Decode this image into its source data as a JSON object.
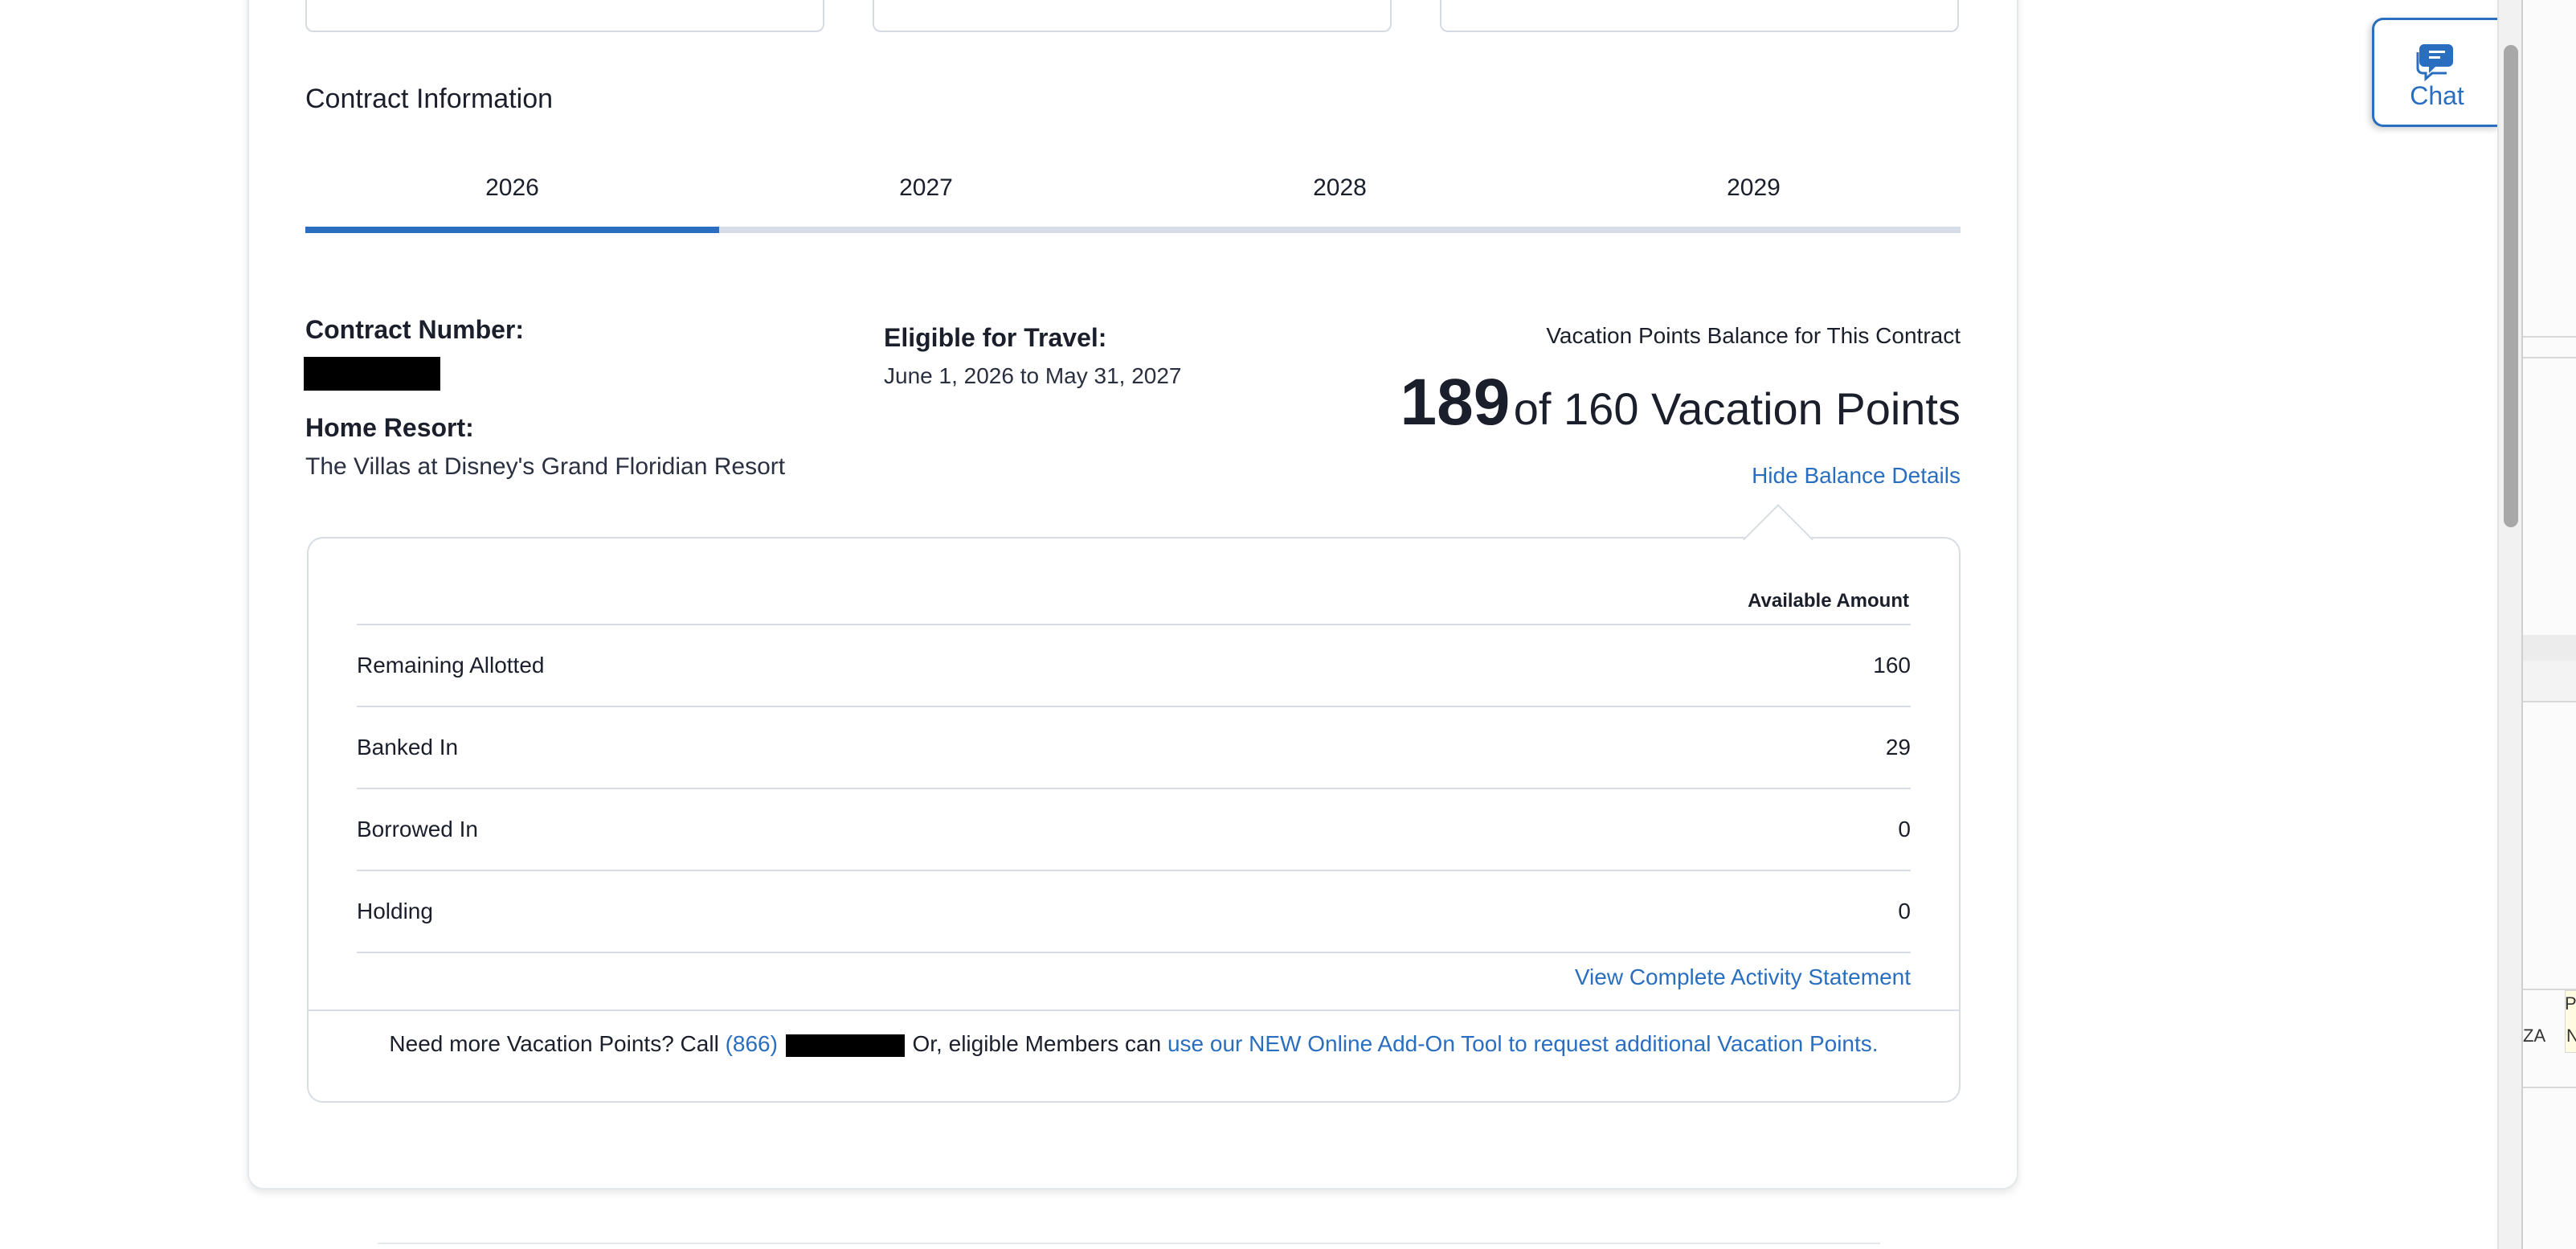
{
  "section": {
    "title": "Contract Information"
  },
  "tabs": [
    {
      "label": "2026",
      "active": true
    },
    {
      "label": "2027",
      "active": false
    },
    {
      "label": "2028",
      "active": false
    },
    {
      "label": "2029",
      "active": false
    }
  ],
  "contract": {
    "number_label": "Contract Number:",
    "home_resort_label": "Home Resort:",
    "home_resort_value": "The Villas at Disney's Grand Floridian Resort",
    "eligible_label": "Eligible for Travel:",
    "eligible_value": "June 1, 2026 to May 31, 2027"
  },
  "balance": {
    "label": "Vacation Points Balance for This Contract",
    "points": "189",
    "rest": "of 160 Vacation Points",
    "hide_link": "Hide Balance Details"
  },
  "details": {
    "column_header": "Available Amount",
    "rows": [
      {
        "label": "Remaining Allotted",
        "value": "160"
      },
      {
        "label": "Banked In",
        "value": "29"
      },
      {
        "label": "Borrowed In",
        "value": "0"
      },
      {
        "label": "Holding",
        "value": "0"
      }
    ],
    "activity_link": "View Complete Activity Statement"
  },
  "footer": {
    "text_before": "Need more Vacation Points? Call ",
    "phone_prefix": "(866)",
    "text_middle": " Or, eligible Members can ",
    "addon_link": "use our NEW Online Add-On Tool to request additional Vacation Points."
  },
  "chat": {
    "label": "Chat"
  },
  "side_app": {
    "text_p": "P",
    "text_za": "ZA",
    "text_n": "N"
  },
  "colors": {
    "accent": "#2a6ebf",
    "tab_inactive": "#d6dde7",
    "border": "#d8dde5"
  }
}
